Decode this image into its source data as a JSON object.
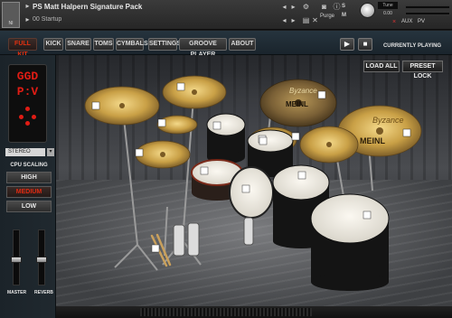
{
  "kontakt": {
    "title": "PS Matt Halpern Signature Pack",
    "snapshot": "00 Startup",
    "purge_label": "Purge",
    "tune_label": "Tune",
    "tune_value": "0.00",
    "s_label": "S",
    "m_label": "M",
    "close_glyph": "×",
    "aux_label": "AUX",
    "pv_label": "PV"
  },
  "tabs": [
    {
      "label": "FULL KIT",
      "active": true
    },
    {
      "label": "KICK"
    },
    {
      "label": "SNARE"
    },
    {
      "label": "TOMS"
    },
    {
      "label": "CYMBALS"
    },
    {
      "label": "SETTINGS"
    },
    {
      "label": "GROOVE PLAYER"
    },
    {
      "label": "ABOUT"
    }
  ],
  "transport": {
    "play_glyph": "▶",
    "stop_glyph": "■",
    "now_playing": "CURRENTLY PLAYING"
  },
  "logo": {
    "line1": "GGD",
    "line2": "P:V"
  },
  "output": {
    "selected": "STEREO",
    "arrow": "▾"
  },
  "cpu": {
    "label": "CPU SCALING",
    "options": [
      "HIGH",
      "MEDIUM",
      "LOW"
    ],
    "selected": "MEDIUM"
  },
  "faders": {
    "master_label": "MASTER",
    "reverb_label": "REVERB",
    "master_level": 0.45,
    "reverb_level": 0.45
  },
  "stage": {
    "load_all": "LOAD ALL",
    "preset_lock": "PRESET LOCK"
  },
  "cymbal_brand": "MEINL",
  "cymbal_series": "Byzance",
  "colors": {
    "accent_red": "#e01c14",
    "cymbal_gold": "#c9a046",
    "drum_white": "#efece4",
    "shell_black": "#141414"
  }
}
